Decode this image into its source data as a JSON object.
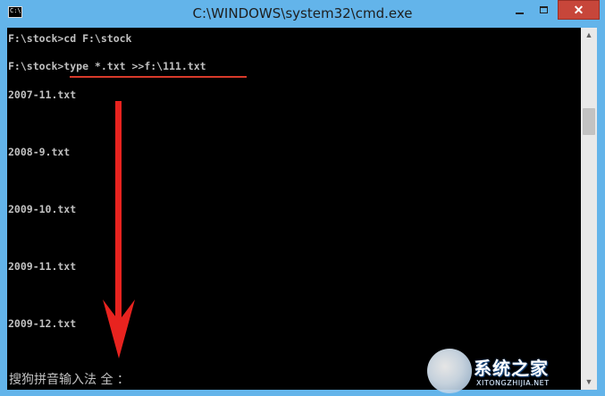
{
  "window": {
    "title": "C:\\WINDOWS\\system32\\cmd.exe",
    "icon_label": "C:\\",
    "close_glyph": "✕"
  },
  "console": {
    "lines": [
      "F:\\stock>cd F:\\stock",
      "F:\\stock>type *.txt >>f:\\111.txt",
      "2007-11.txt",
      "2008-9.txt",
      "2009-10.txt",
      "2009-11.txt",
      "2009-12.txt"
    ],
    "ime_status": "搜狗拼音输入法 全 ："
  },
  "scrollbar": {
    "up_glyph": "▲",
    "down_glyph": "▼"
  },
  "annotation": {
    "color": "#d83a2a"
  },
  "watermark": {
    "brand": "系统之家",
    "url": "XITONGZHIJIA.NET"
  },
  "colors": {
    "title_bar": "#63b4ea",
    "console_bg": "#000000",
    "console_text": "#c0c0c0",
    "close_button": "#c7463a"
  }
}
